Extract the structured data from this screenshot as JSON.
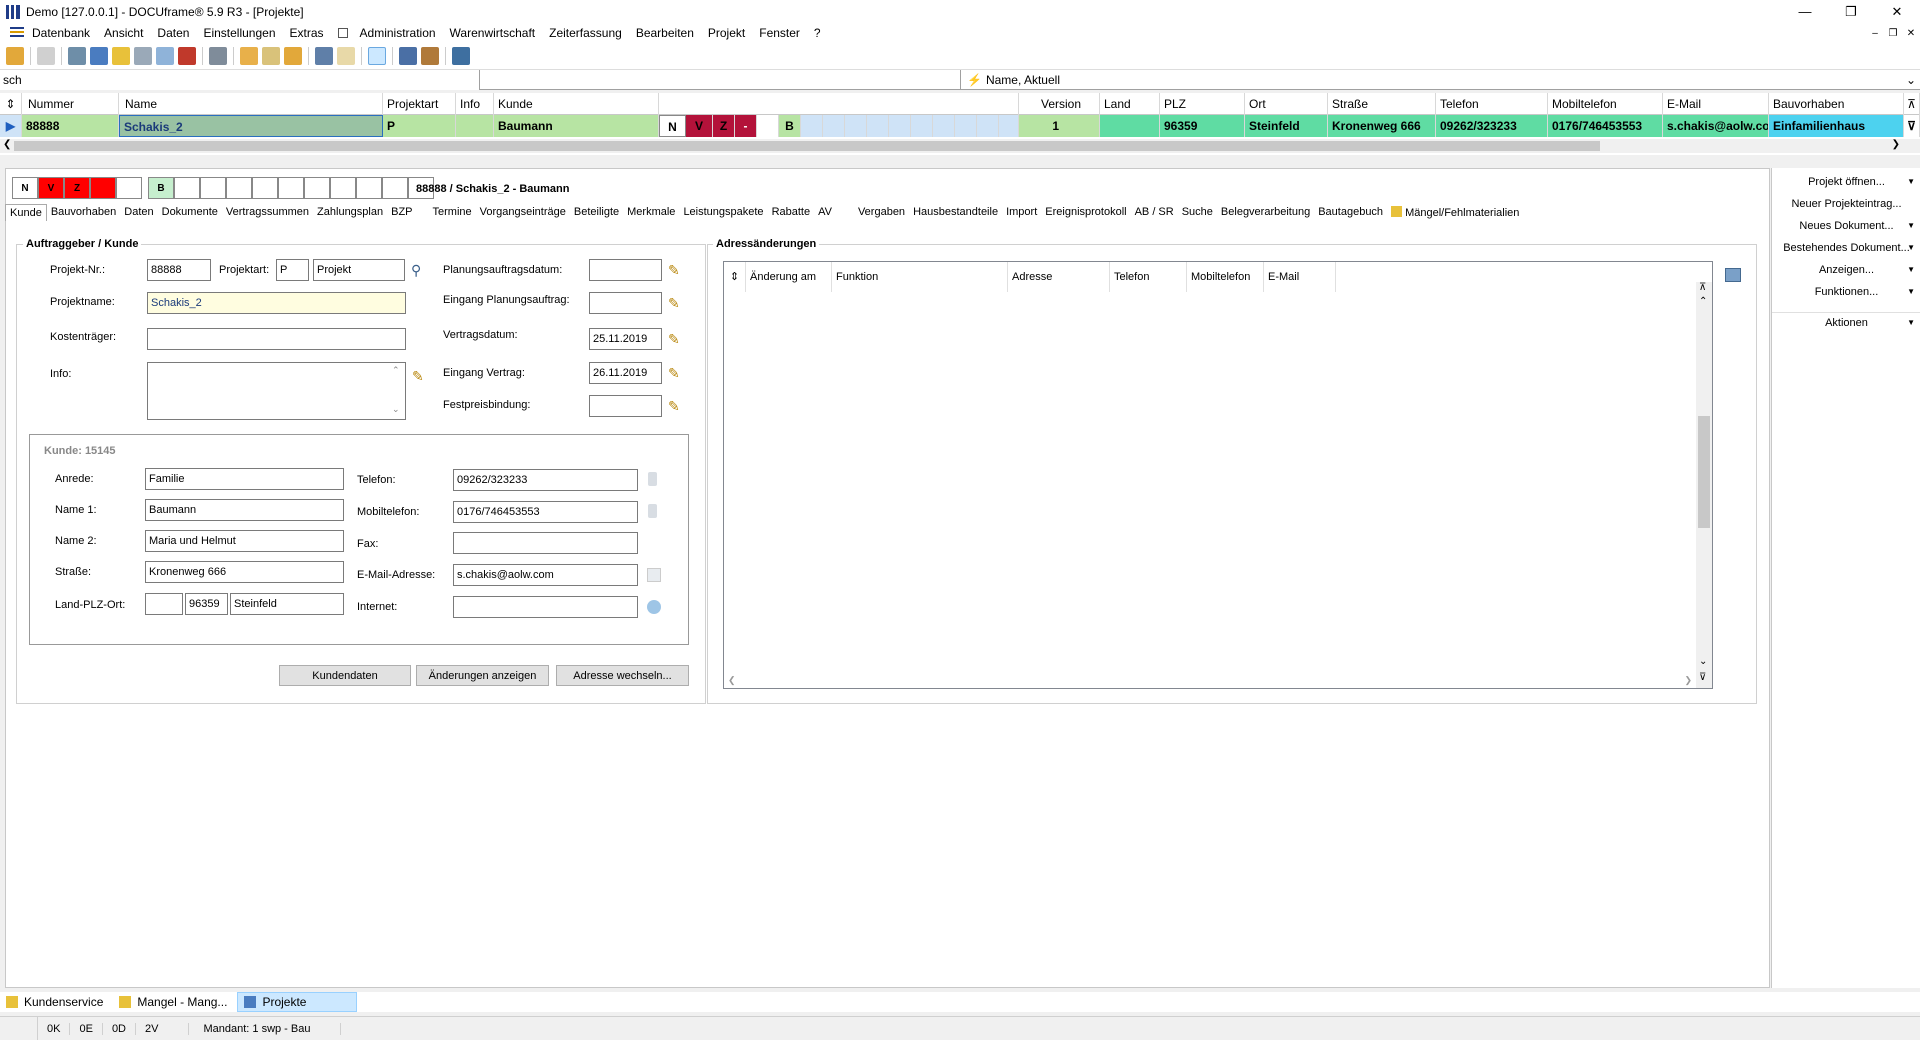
{
  "window": {
    "title": "Demo [127.0.0.1] - DOCUframe® 5.9 R3 - [Projekte]"
  },
  "menu": [
    "Datenbank",
    "Ansicht",
    "Daten",
    "Einstellungen",
    "Extras",
    "Administration",
    "Warenwirtschaft",
    "Zeiterfassung",
    "Bearbeiten",
    "Projekt",
    "Fenster",
    "?"
  ],
  "search": {
    "value": "sch"
  },
  "sort": {
    "value": "Name, Aktuell"
  },
  "grid": {
    "headers": [
      "Nummer",
      "Name",
      "Projektart",
      "Info",
      "Kunde",
      "Version",
      "Land",
      "PLZ",
      "Ort",
      "Straße",
      "Telefon",
      "Mobiltelefon",
      "E-Mail",
      "Bauvorhaben"
    ],
    "row": {
      "nummer": "88888",
      "name": "Schakis_2",
      "projektart": "P",
      "info": "",
      "kunde": "Baumann",
      "flags": [
        "N",
        "V",
        "Z",
        "-",
        "",
        "B"
      ],
      "version": "1",
      "land": "",
      "plz": "96359",
      "ort": "Steinfeld",
      "strasse": "Kronenweg 666",
      "telefon": "09262/323233",
      "mobil": "0176/746453553",
      "email": "s.chakis@aolw.com",
      "bauvorhaben": "Einfamilienhaus"
    }
  },
  "status_boxes": [
    "N",
    "V",
    "Z",
    "",
    "",
    "B"
  ],
  "project_header": "88888 / Schakis_2 - Baumann",
  "tabs": [
    "Kunde",
    "Bauvorhaben",
    "Daten",
    "Dokumente",
    "Vertragssummen",
    "Zahlungsplan",
    "BZP",
    "Termine",
    "Vorgangseinträge",
    "Beteiligte",
    "Merkmale",
    "Leistungspakete",
    "Rabatte",
    "AV",
    "Vergaben",
    "Hausbestandteile",
    "Import",
    "Ereignisprotokoll",
    "AB / SR",
    "Suche",
    "Belegverarbeitung",
    "Bautagebuch",
    "Mängel/Fehlmaterialien"
  ],
  "auftraggeber": {
    "title": "Auftraggeber / Kunde",
    "projekt_nr_label": "Projekt-Nr.:",
    "projekt_nr": "88888",
    "projektart_label": "Projektart:",
    "projektart_code": "P",
    "projektart_name": "Projekt",
    "projektname_label": "Projektname:",
    "projektname": "Schakis_2",
    "kostentraeger_label": "Kostenträger:",
    "kostentraeger": "",
    "info_label": "Info:",
    "info": "",
    "planungsauftragsdatum_label": "Planungsauftragsdatum:",
    "planungsauftragsdatum": "",
    "eingang_planung_label": "Eingang Planungsauftrag:",
    "eingang_planung": "",
    "vertragsdatum_label": "Vertragsdatum:",
    "vertragsdatum": "25.11.2019",
    "eingang_vertrag_label": "Eingang Vertrag:",
    "eingang_vertrag": "26.11.2019",
    "festpreis_label": "Festpreisbindung:",
    "festpreis": ""
  },
  "kunde": {
    "title": "Kunde: 15145",
    "anrede_label": "Anrede:",
    "anrede": "Familie",
    "name1_label": "Name 1:",
    "name1": "Baumann",
    "name2_label": "Name 2:",
    "name2": "Maria und Helmut",
    "strasse_label": "Straße:",
    "strasse": "Kronenweg 666",
    "ort_label": "Land-PLZ-Ort:",
    "land": "",
    "plz": "96359",
    "ort": "Steinfeld",
    "telefon_label": "Telefon:",
    "telefon": "09262/323233",
    "mobil_label": "Mobiltelefon:",
    "mobil": "0176/746453553",
    "fax_label": "Fax:",
    "fax": "",
    "email_label": "E-Mail-Adresse:",
    "email": "s.chakis@aolw.com",
    "internet_label": "Internet:",
    "internet": ""
  },
  "buttons": {
    "kundendaten": "Kundendaten",
    "aenderungen": "Änderungen anzeigen",
    "adresse": "Adresse wechseln..."
  },
  "adressaenderungen": {
    "title": "Adressänderungen",
    "headers": [
      "Änderung am",
      "Funktion",
      "Adresse",
      "Telefon",
      "Mobiltelefon",
      "E-Mail"
    ]
  },
  "right_panel": [
    "Projekt öffnen...",
    "Neuer Projekteintrag...",
    "Neues Dokument...",
    "Bestehendes Dokument...",
    "Anzeigen...",
    "Funktionen...",
    "Aktionen"
  ],
  "taskbar": [
    "Kundenservice",
    "Mangel - Mang...",
    "Projekte"
  ],
  "statusbar": [
    "0K",
    "0E",
    "0D",
    "2V",
    "Mandant: 1 swp - Bau"
  ],
  "colors": {
    "row_green": "#b7e4a3",
    "row_teal": "#5fdca3",
    "flag_red": "#c8102e",
    "flag_box_red": "#ff0000",
    "flag_green": "#c6efce",
    "bauvorhaben_cyan": "#4dd2ef",
    "selected_name": "#99c2a3"
  }
}
